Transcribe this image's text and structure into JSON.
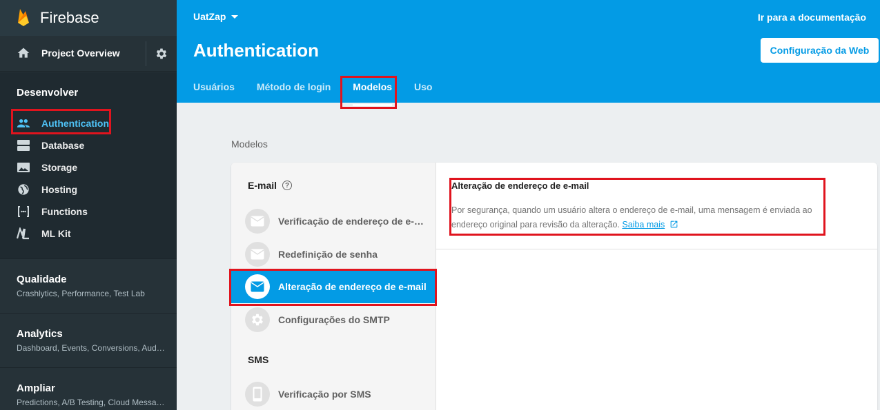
{
  "sidebar": {
    "brand": "Firebase",
    "overview": "Project Overview",
    "develop_heading": "Desenvolver",
    "items": [
      {
        "label": "Authentication",
        "icon": "people-icon"
      },
      {
        "label": "Database",
        "icon": "database-icon"
      },
      {
        "label": "Storage",
        "icon": "image-icon"
      },
      {
        "label": "Hosting",
        "icon": "globe-icon"
      },
      {
        "label": "Functions",
        "icon": "functions-icon"
      },
      {
        "label": "ML Kit",
        "icon": "ml-kit-icon"
      }
    ],
    "sections": [
      {
        "title": "Qualidade",
        "subtitle": "Crashlytics, Performance, Test Lab"
      },
      {
        "title": "Analytics",
        "subtitle": "Dashboard, Events, Conversions, Audiences"
      },
      {
        "title": "Ampliar",
        "subtitle": "Predictions, A/B Testing, Cloud Messaging"
      }
    ]
  },
  "header": {
    "project": "UatZap",
    "docs_link": "Ir para a documentação",
    "title": "Authentication",
    "web_config": "Configuração da Web",
    "tabs": [
      "Usuários",
      "Método de login",
      "Modelos",
      "Uso"
    ],
    "active_tab": "Modelos"
  },
  "main": {
    "section_label": "Modelos",
    "email_group": "E-mail",
    "email_templates": [
      "Verificação de endereço de e-mail",
      "Redefinição de senha",
      "Alteração de endereço de e-mail",
      "Configurações do SMTP"
    ],
    "sms_group": "SMS",
    "sms_templates": [
      "Verificação por SMS"
    ],
    "detail": {
      "title": "Alteração de endereço de e-mail",
      "text": "Por segurança, quando um usuário altera o endereço de e-mail, uma mensagem é enviada ao endereço original para revisão da alteração.",
      "learn_more": "Saiba mais"
    }
  },
  "colors": {
    "header_blue": "#039be5",
    "sidebar_dark": "#263238",
    "active_text": "#4fc3f7",
    "highlight_red": "#e0141e"
  }
}
